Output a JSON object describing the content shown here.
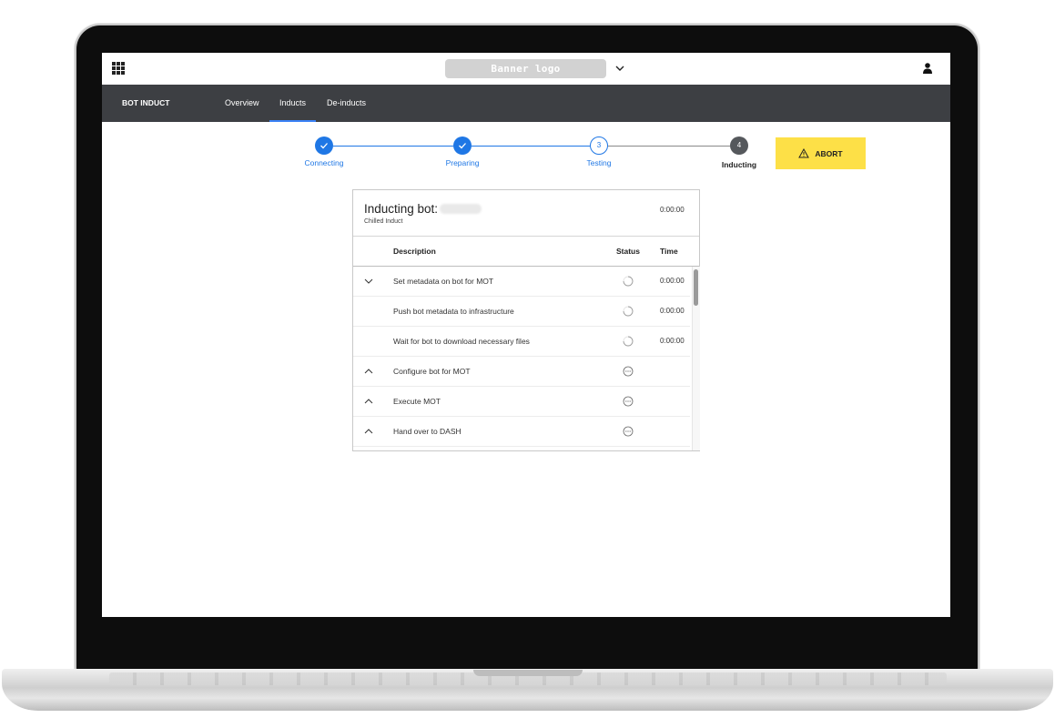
{
  "topbar": {
    "banner_logo": "Banner logo",
    "icons": {
      "apps": "apps-grid-icon",
      "banner_dropdown": "chevron-down-icon",
      "user": "user-icon"
    }
  },
  "navbar": {
    "brand": "BOT INDUCT",
    "tabs": [
      {
        "label": "Overview",
        "active": false
      },
      {
        "label": "Inducts",
        "active": true
      },
      {
        "label": "De-inducts",
        "active": false
      }
    ]
  },
  "stepper": {
    "steps": [
      {
        "number": "1",
        "label": "Connecting",
        "state": "done"
      },
      {
        "number": "2",
        "label": "Preparing",
        "state": "done"
      },
      {
        "number": "3",
        "label": "Testing",
        "state": "current"
      },
      {
        "number": "4",
        "label": "Inducting",
        "state": "pending"
      }
    ],
    "abort_label": "ABORT",
    "abort_icon": "warning-triangle-icon"
  },
  "panel": {
    "title": "Inducting bot:",
    "subtitle": "Chilled Induct",
    "timer": "0:00:00",
    "columns": {
      "description": "Description",
      "status": "Status",
      "time": "Time"
    },
    "rows": [
      {
        "expand": "collapse",
        "description": "Set metadata on bot for MOT",
        "status": "in-progress",
        "time": "0:00:00"
      },
      {
        "expand": "none",
        "description": "Push bot metadata to infrastructure",
        "status": "in-progress",
        "time": "0:00:00"
      },
      {
        "expand": "none",
        "description": "Wait for bot to download necessary files",
        "status": "in-progress",
        "time": "0:00:00"
      },
      {
        "expand": "expand",
        "description": "Configure bot for MOT",
        "status": "pending",
        "time": ""
      },
      {
        "expand": "expand",
        "description": "Execute MOT",
        "status": "pending",
        "time": ""
      },
      {
        "expand": "expand",
        "description": "Hand over to DASH",
        "status": "pending",
        "time": ""
      }
    ]
  },
  "colors": {
    "accent": "#1f77e5",
    "navbar": "#3d3f43",
    "abort": "#fde047",
    "step_pending": "#55585c"
  }
}
